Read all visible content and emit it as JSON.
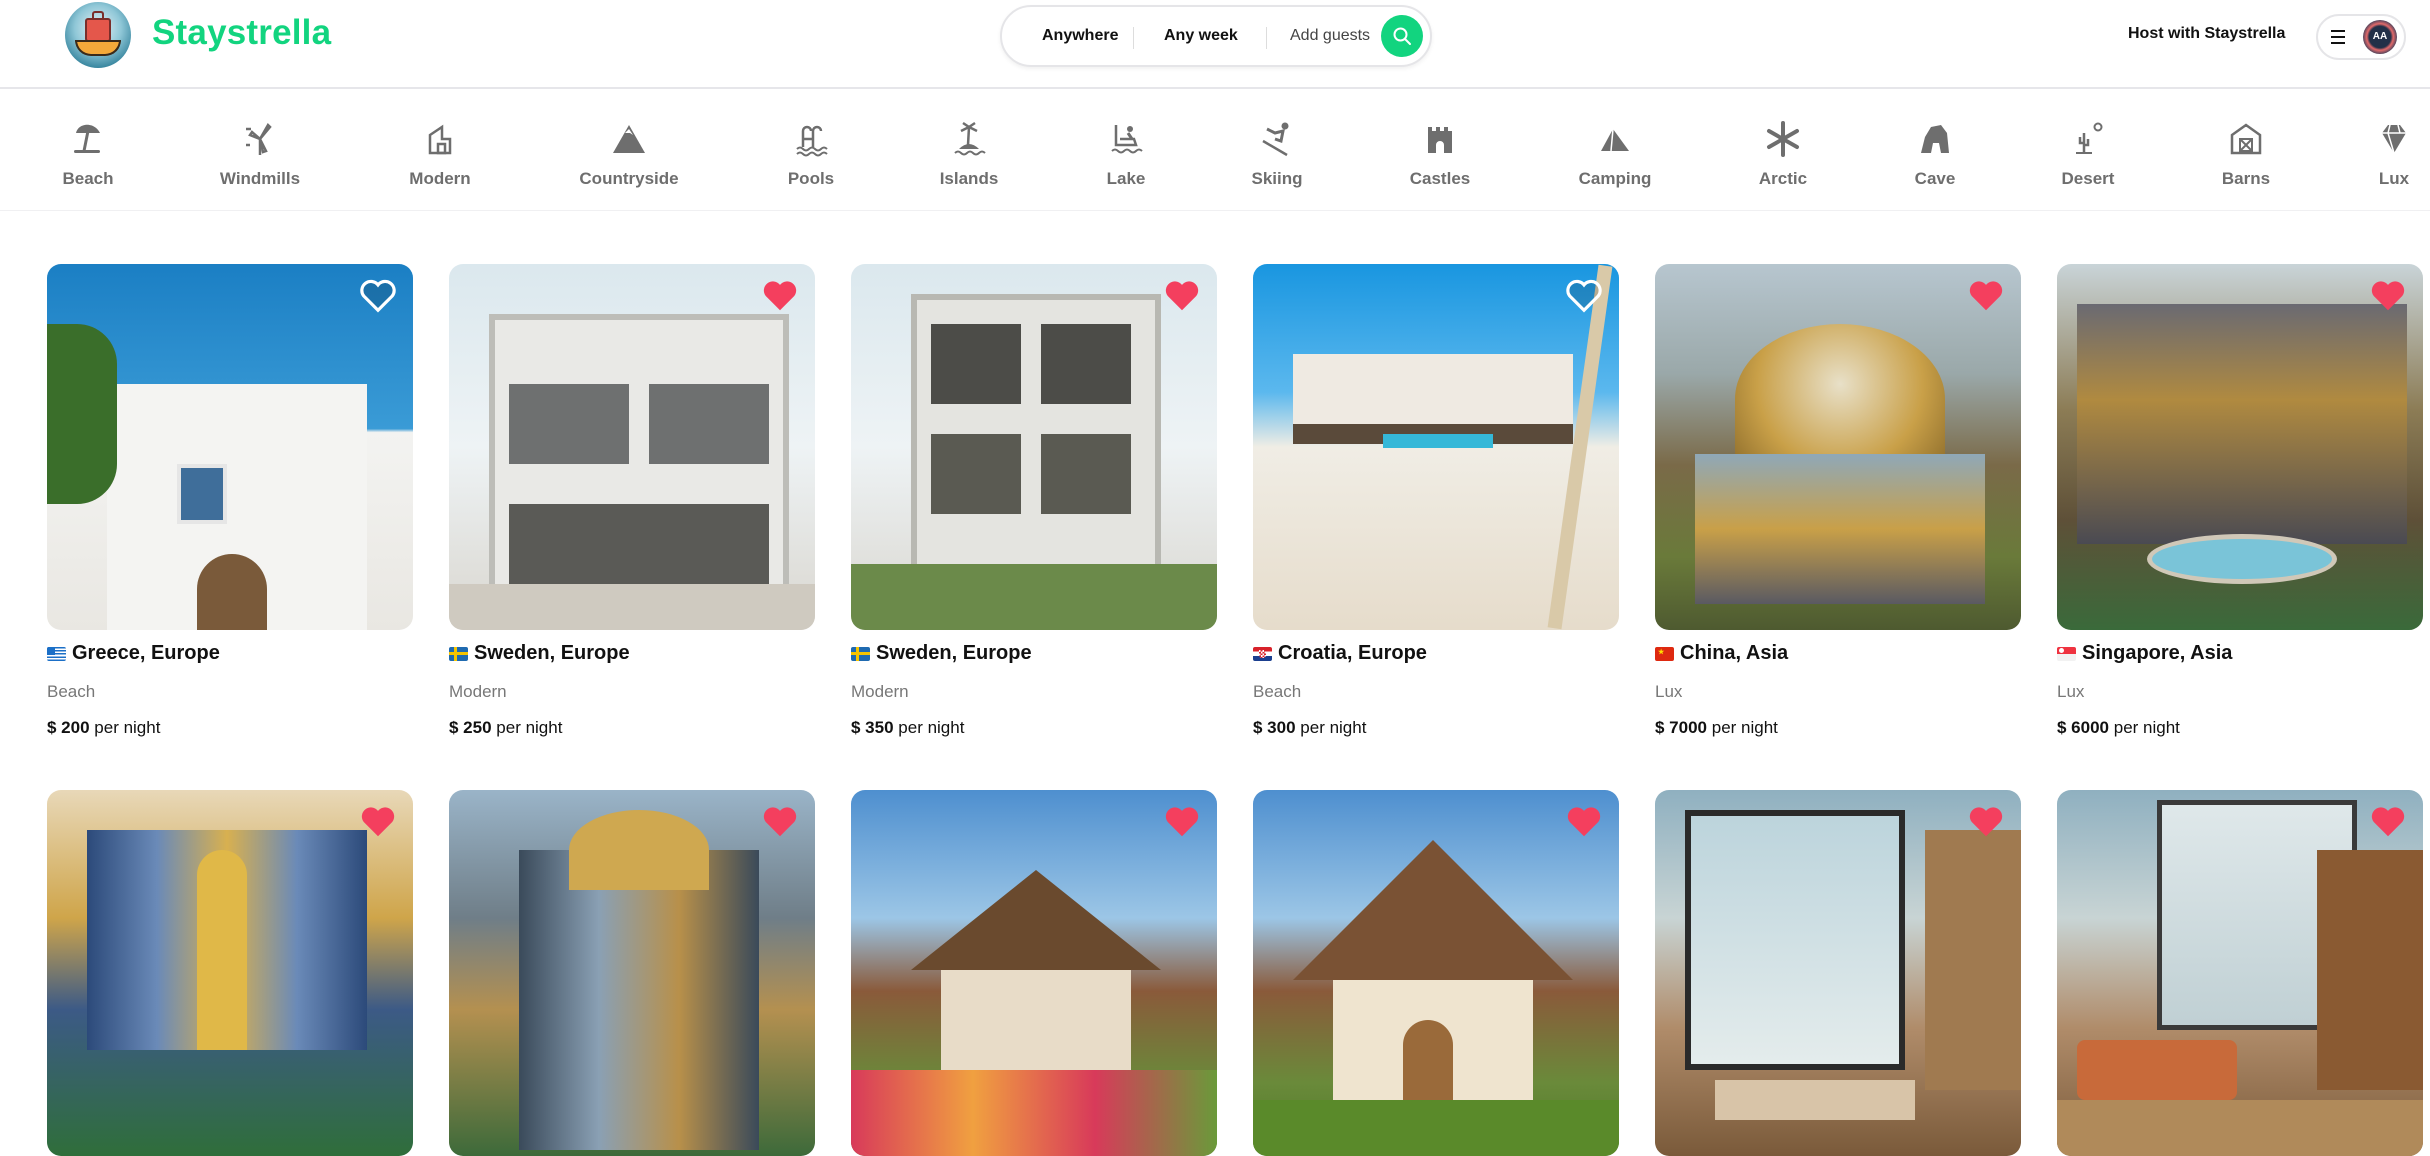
{
  "header": {
    "brand": "Staystrella",
    "search": {
      "where": "Anywhere",
      "when": "Any week",
      "guests_placeholder": "Add guests"
    },
    "host_link": "Host with Staystrella",
    "avatar_initials": "AA",
    "colors": {
      "brand": "#12d47f",
      "favorite": "#f43f5e"
    }
  },
  "categories": [
    {
      "label": "Beach",
      "icon": "beach-umbrella-icon"
    },
    {
      "label": "Windmills",
      "icon": "windmill-icon"
    },
    {
      "label": "Modern",
      "icon": "modern-building-icon"
    },
    {
      "label": "Countryside",
      "icon": "mountain-icon"
    },
    {
      "label": "Pools",
      "icon": "pool-icon"
    },
    {
      "label": "Islands",
      "icon": "island-icon"
    },
    {
      "label": "Lake",
      "icon": "lake-boat-icon"
    },
    {
      "label": "Skiing",
      "icon": "skiing-icon"
    },
    {
      "label": "Castles",
      "icon": "castle-icon"
    },
    {
      "label": "Camping",
      "icon": "tent-icon"
    },
    {
      "label": "Arctic",
      "icon": "snowflake-icon"
    },
    {
      "label": "Cave",
      "icon": "cave-icon"
    },
    {
      "label": "Desert",
      "icon": "cactus-icon"
    },
    {
      "label": "Barns",
      "icon": "barn-icon"
    },
    {
      "label": "Lux",
      "icon": "diamond-icon"
    }
  ],
  "listings": [
    {
      "location": "Greece, Europe",
      "flag": "greece",
      "category": "Beach",
      "price": "$ 200",
      "price_suffix": "per night",
      "favorited": false
    },
    {
      "location": "Sweden, Europe",
      "flag": "sweden",
      "category": "Modern",
      "price": "$ 250",
      "price_suffix": "per night",
      "favorited": true
    },
    {
      "location": "Sweden, Europe",
      "flag": "sweden",
      "category": "Modern",
      "price": "$ 350",
      "price_suffix": "per night",
      "favorited": true
    },
    {
      "location": "Croatia, Europe",
      "flag": "croatia",
      "category": "Beach",
      "price": "$ 300",
      "price_suffix": "per night",
      "favorited": false
    },
    {
      "location": "China, Asia",
      "flag": "china",
      "category": "Lux",
      "price": "$ 7000",
      "price_suffix": "per night",
      "favorited": true
    },
    {
      "location": "Singapore, Asia",
      "flag": "singapore",
      "category": "Lux",
      "price": "$ 6000",
      "price_suffix": "per night",
      "favorited": true
    },
    {
      "favorited": true
    },
    {
      "favorited": true
    },
    {
      "favorited": true
    },
    {
      "favorited": true
    },
    {
      "favorited": true
    },
    {
      "favorited": true
    }
  ]
}
